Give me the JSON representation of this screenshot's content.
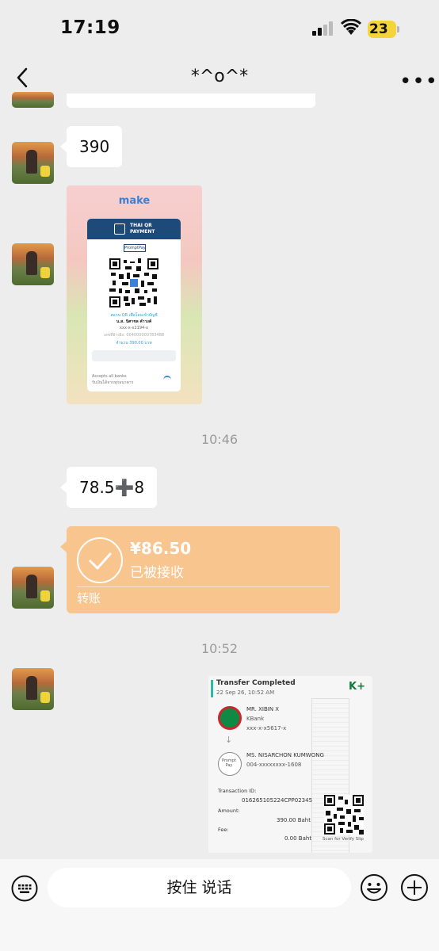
{
  "status_bar": {
    "time": "17:19",
    "battery": "23"
  },
  "header": {
    "title": "*^o^*"
  },
  "messages": {
    "msg_390": "390",
    "time_1": "10:46",
    "msg_calc": "78.5➕8",
    "time_2": "10:52"
  },
  "qr_image": {
    "brand": "make",
    "head_title": "THAI QR",
    "head_sub": "PAYMENT",
    "promptpay": "PromptPay",
    "line1": "สแกน QR เพื่อโอนเข้าบัญชี",
    "name": "น.ส. นิศาชล คำวงค์",
    "account": "xxx-x-x2194-x",
    "ref": "เลขที่อ้างอิง: 004000000783488",
    "amount": "จำนวน 390.00 บาท",
    "accepts": "Accepts all banks",
    "accepts_th": "รับเงินได้จากทุกธนาคาร"
  },
  "transfer": {
    "amount": "¥86.50",
    "status": "已被接收",
    "label": "转账",
    "accent": "#f9c58f"
  },
  "slip": {
    "title": "Transfer Completed",
    "date": "22 Sep 26, 10:52 AM",
    "logo": "K+",
    "from_name": "MR. XIBIN X",
    "from_bank": "KBank",
    "from_acct": "xxx-x-x5617-x",
    "to_icon": "Prompt Pay",
    "to_name": "MS. NISARCHON KUMWONG",
    "to_acct": "004-xxxxxxxx-1608",
    "txn_label": "Transaction ID:",
    "txn_id": "016265105224CPP02345",
    "amount_label": "Amount:",
    "amount": "390.00 Baht",
    "fee_label": "Fee:",
    "fee": "0.00 Baht",
    "verify": "Scan for Verify Slip"
  },
  "input_bar": {
    "voice_label": "按住 说话"
  }
}
